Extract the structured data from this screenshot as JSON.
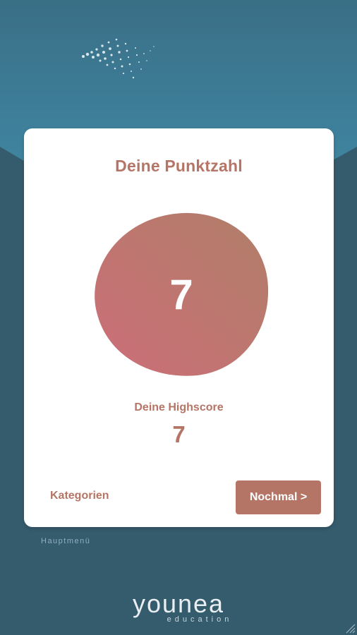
{
  "colors": {
    "accent": "#b57566",
    "background": "#355c6d",
    "header_band": "#3f7d96",
    "card": "#ffffff"
  },
  "score_card": {
    "title": "Deine Punktzahl",
    "score": "7",
    "highscore_label": "Deine Highscore",
    "highscore": "7"
  },
  "actions": {
    "categories_label": "Kategorien",
    "again_label": "Nochmal >"
  },
  "footer": {
    "main_menu_label": "Hauptmenü",
    "logo_word": "younea",
    "logo_sub": "education"
  },
  "icons": {
    "decoration": "particles-icon",
    "resize": "resize-grip-icon"
  }
}
